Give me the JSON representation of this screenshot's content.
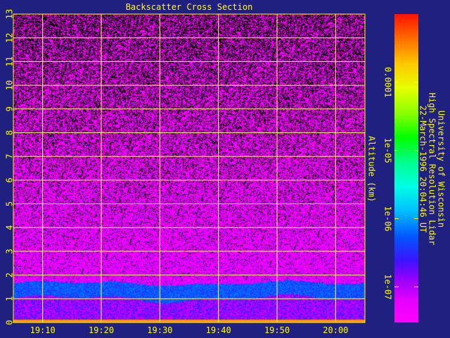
{
  "chart_data": {
    "type": "heatmap",
    "title": "Backscatter Cross Section",
    "ylabel": "Altitude (km)",
    "y_ticks": [
      "0",
      "1",
      "2",
      "3",
      "4",
      "5",
      "6",
      "7",
      "8",
      "9",
      "10",
      "11",
      "12",
      "13"
    ],
    "ylim": [
      0,
      13
    ],
    "x_ticks": [
      "19:10",
      "19:20",
      "19:30",
      "19:40",
      "19:50",
      "20:00"
    ],
    "xlim": [
      "19:05",
      "20:05"
    ],
    "grid": true,
    "colorbar": {
      "scale": "log",
      "range": [
        3e-08,
        0.001
      ],
      "ticks": [
        "1e-07",
        "1e-06",
        "1e-05",
        "0.0001"
      ]
    },
    "annotation_lines": [
      "University of Wisconsin",
      "High Spectral Resolution Lidar",
      "22-March-1996 20:04:46 UT"
    ],
    "features": [
      {
        "name": "aerosol layer",
        "altitude_range_km": [
          1.0,
          1.8
        ]
      },
      {
        "name": "ground return",
        "altitude_km": 0.0
      }
    ]
  },
  "colors": {
    "background": "#202080",
    "axis": "#ffff00",
    "grid": "#ffff66"
  }
}
